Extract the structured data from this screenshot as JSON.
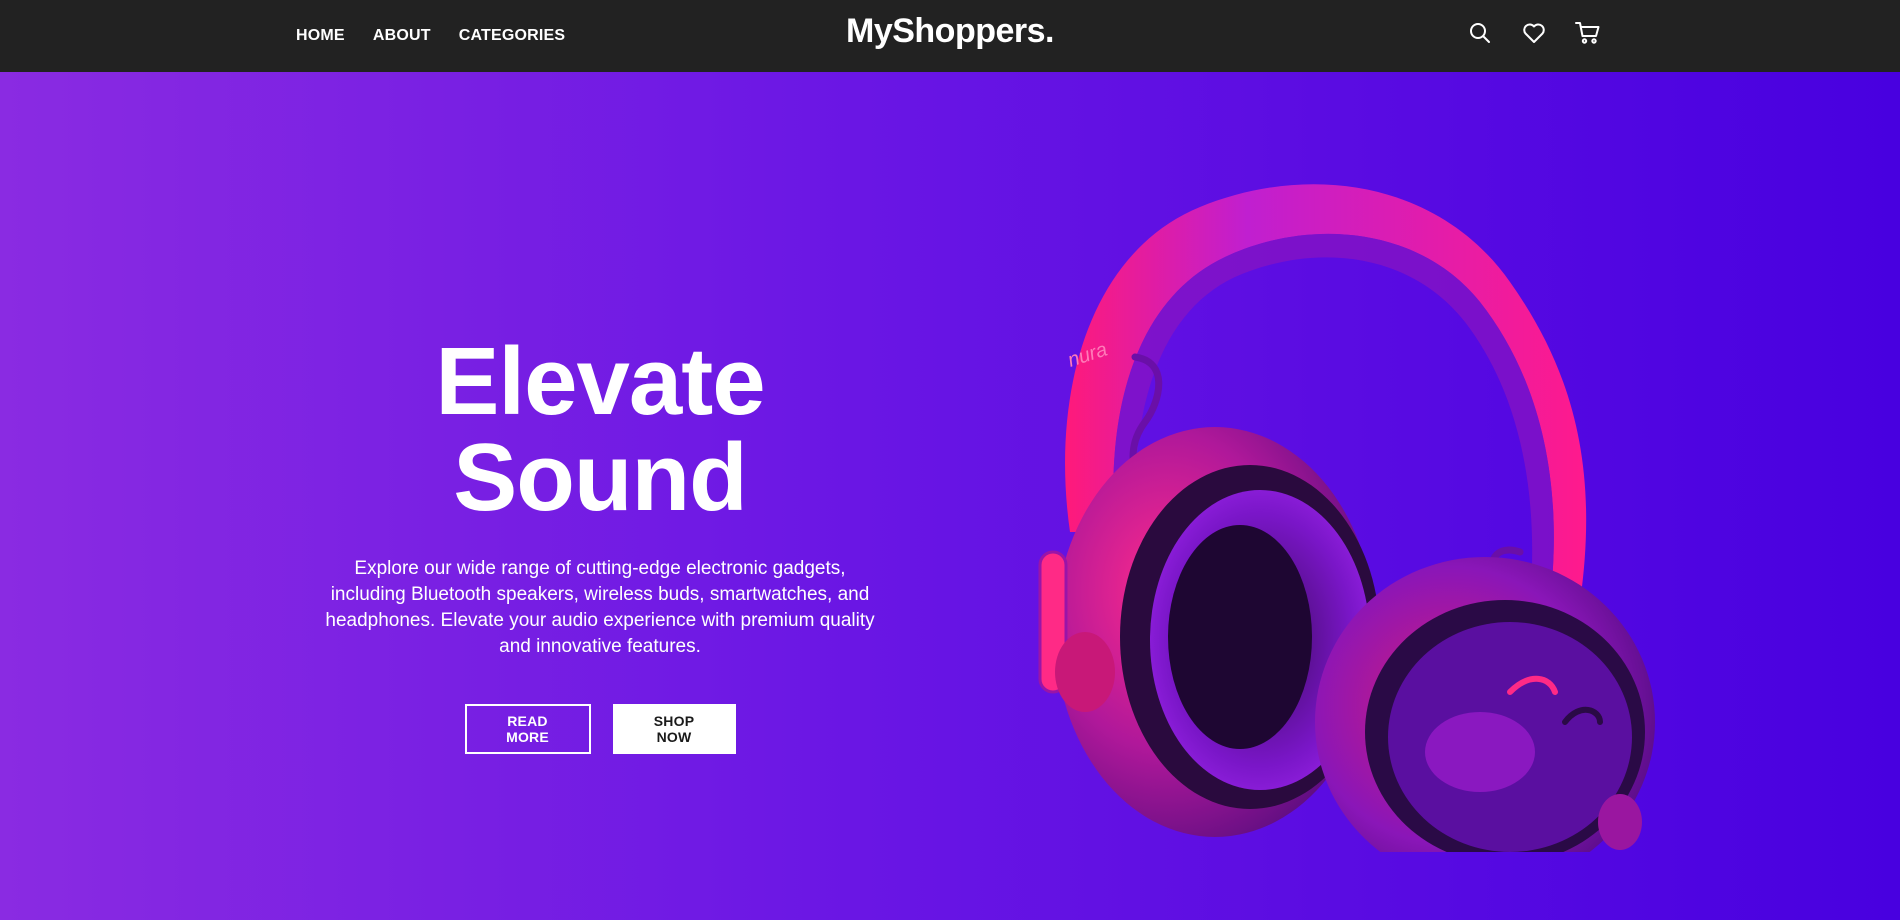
{
  "nav": {
    "links": [
      {
        "label": "HOME"
      },
      {
        "label": "ABOUT"
      },
      {
        "label": "CATEGORIES"
      }
    ],
    "brand": "MyShoppers.",
    "icons": [
      "search-icon",
      "heart-icon",
      "cart-icon"
    ]
  },
  "hero": {
    "title": "Elevate Sound",
    "description": "Explore our wide range of cutting-edge electronic gadgets, including Bluetooth speakers, wireless buds, smartwatches, and headphones. Elevate your audio experience with premium quality and innovative features.",
    "buttons": {
      "read_more": "READ MORE",
      "shop_now": "SHOP NOW"
    },
    "image": {
      "subject": "headphones",
      "brand_text": "nura"
    }
  },
  "colors": {
    "navbar": "#222222",
    "hero_gradient_start": "#8a2be2",
    "hero_gradient_end": "#4800e0",
    "headphone_pink": "#ff1a8c",
    "headphone_purple": "#7b1fd6",
    "text": "#ffffff"
  }
}
